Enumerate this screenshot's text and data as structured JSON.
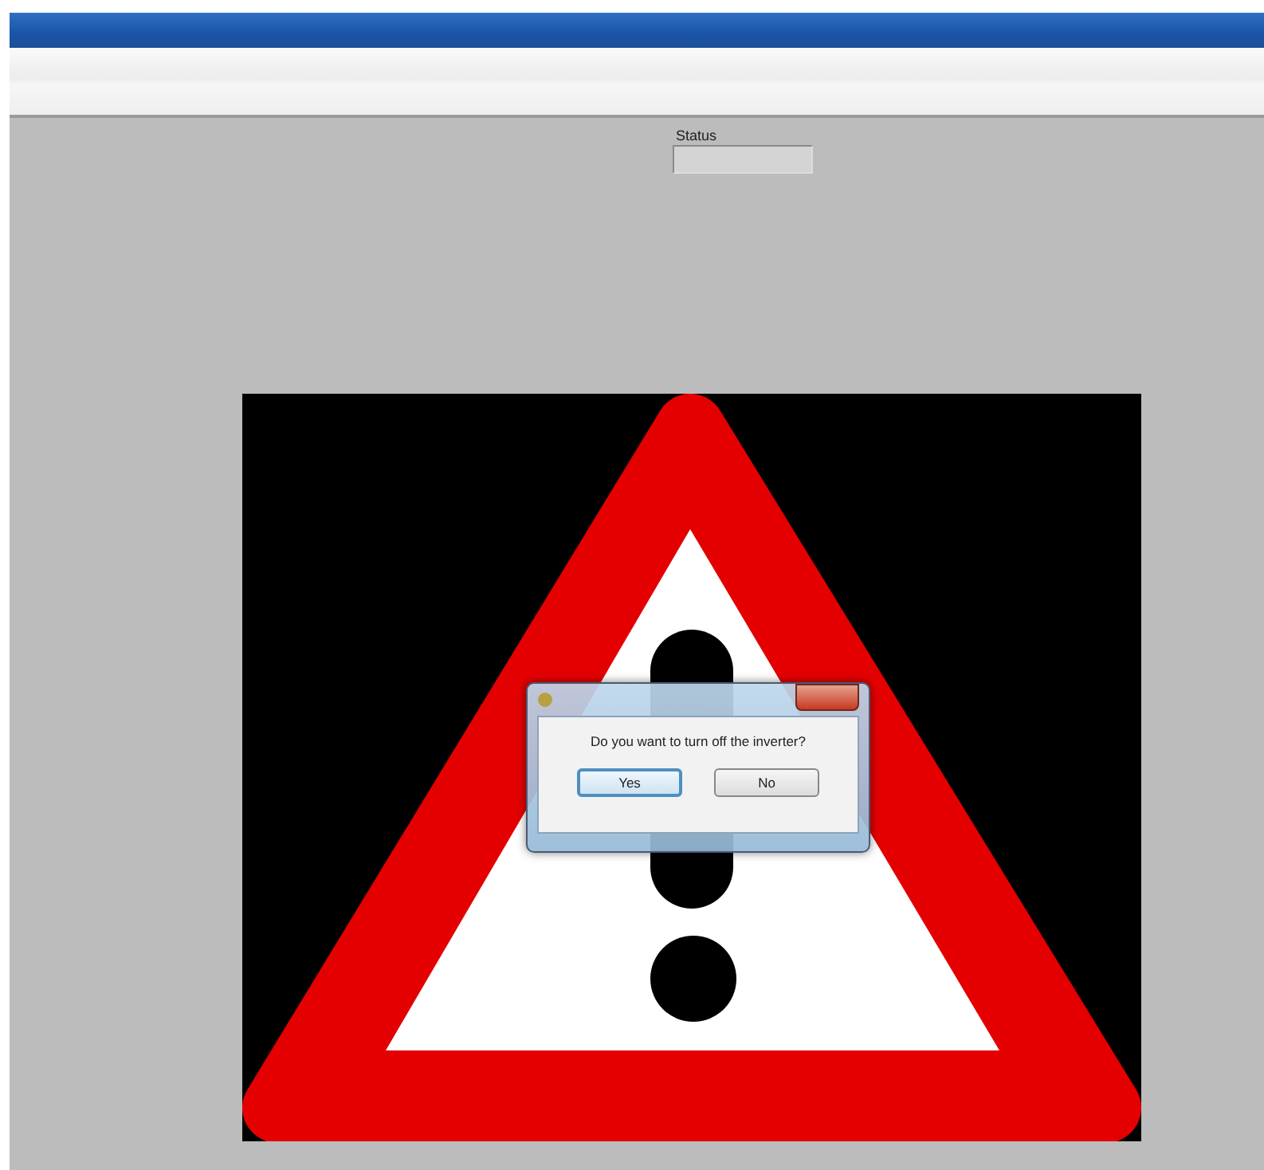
{
  "status": {
    "label": "Status"
  },
  "dialog": {
    "message": "Do you want to turn off the inverter?",
    "buttons": [
      {
        "label": "Yes",
        "focused": true
      },
      {
        "label": "No",
        "focused": false
      }
    ]
  }
}
